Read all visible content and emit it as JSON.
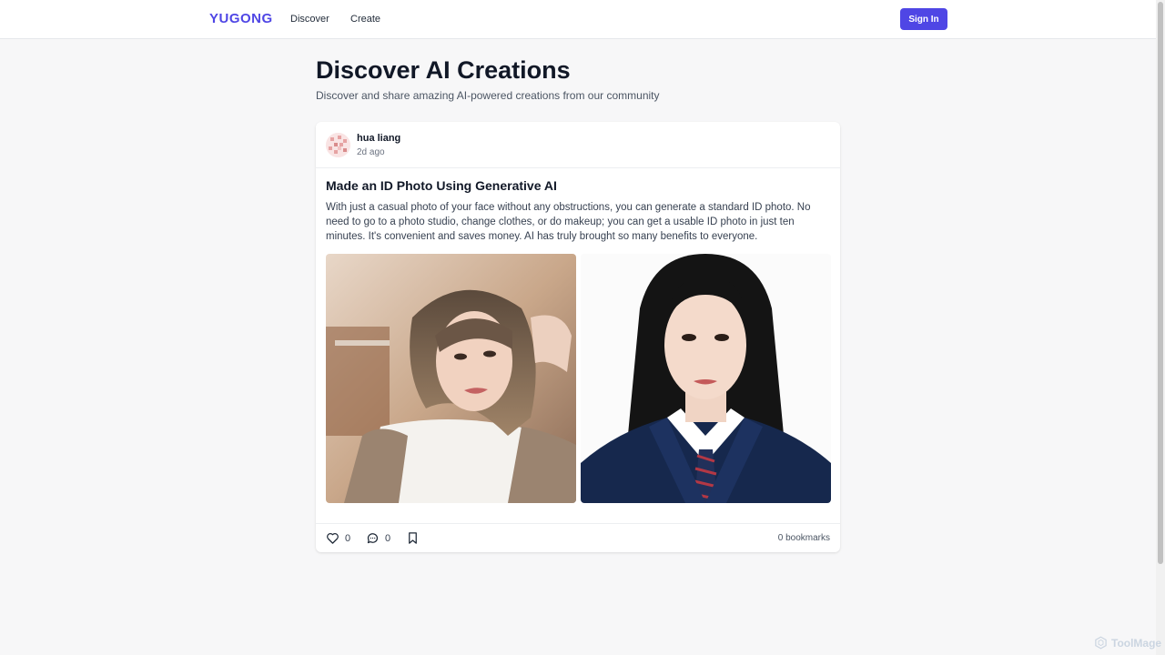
{
  "header": {
    "brand": "YUGONG",
    "nav": [
      {
        "label": "Discover"
      },
      {
        "label": "Create"
      }
    ],
    "sign_in_label": "Sign In"
  },
  "page": {
    "title": "Discover AI Creations",
    "subtitle": "Discover and share amazing AI-powered creations from our community"
  },
  "post": {
    "author": "hua liang",
    "time": "2d ago",
    "title": "Made an ID Photo Using Generative AI",
    "body": "With just a casual photo of your face without any obstructions, you can generate a standard ID photo. No need to go to a photo studio, change clothes, or do makeup; you can get a usable ID photo in just ten minutes. It's convenient and saves money. AI has truly brought so many benefits to everyone.",
    "images": [
      {
        "icon": "casual-portrait-photo"
      },
      {
        "icon": "id-portrait-photo"
      }
    ],
    "likes": "0",
    "comments": "0",
    "bookmarks_text": "0 bookmarks"
  },
  "watermark": "ToolMage",
  "colors": {
    "accent": "#4f46e5",
    "background": "#f7f7f8"
  }
}
